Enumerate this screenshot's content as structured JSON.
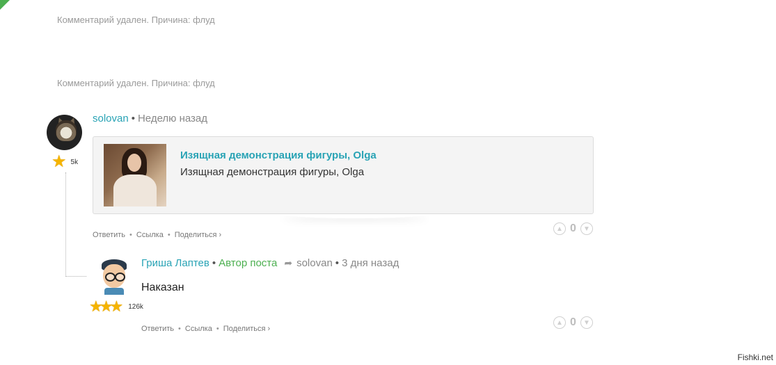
{
  "deleted_comments": [
    {
      "text": "Комментарий удален. Причина: флуд"
    },
    {
      "text": "Комментарий удален. Причина: флуд"
    }
  ],
  "comment1": {
    "username": "solovan",
    "separator": "•",
    "time": "Неделю назад",
    "rating_count": "5k",
    "card": {
      "title": "Изящная демонстрация фигуры, Olga",
      "description": "Изящная демонстрация фигуры, Olga"
    },
    "actions": {
      "reply": "Ответить",
      "link": "Ссылка",
      "share": "Поделиться ›",
      "dot": "•"
    },
    "votes": "0"
  },
  "comment2": {
    "username": "Гриша Лаптев",
    "separator": "•",
    "badge": "Автор поста",
    "reply_to": "solovan",
    "time": "3 дня назад",
    "text": "Наказан",
    "rating_count": "126k",
    "actions": {
      "reply": "Ответить",
      "link": "Ссылка",
      "share": "Поделиться ›",
      "dot": "•"
    },
    "votes": "0"
  },
  "icons": {
    "star": "★",
    "reply_arrow": "➦",
    "like": "👍",
    "dislike": "👎"
  },
  "colors": {
    "link": "#29a3b5",
    "author_badge": "#4caf50",
    "star": "#f5b400"
  },
  "watermark": "Fishki.net"
}
